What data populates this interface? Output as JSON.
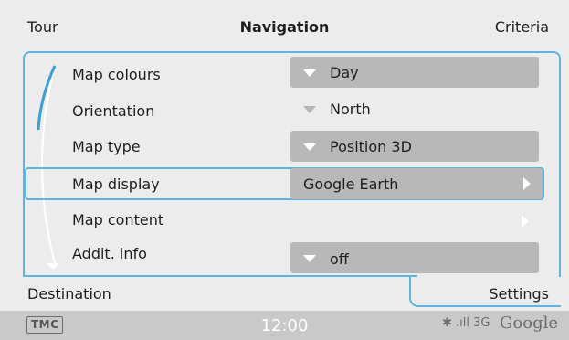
{
  "header": {
    "left_tab": "Tour",
    "title": "Navigation",
    "right_tab": "Criteria"
  },
  "settings": [
    {
      "label": "Map colours",
      "value": "Day",
      "control": "dropdown"
    },
    {
      "label": "Orientation",
      "value": "North",
      "control": "dropdown-disabled"
    },
    {
      "label": "Map type",
      "value": "Position 3D",
      "control": "dropdown"
    },
    {
      "label": "Map display",
      "value": "Google Earth",
      "control": "submenu",
      "selected": true
    },
    {
      "label": "Map content",
      "value": "",
      "control": "submenu"
    },
    {
      "label": "Addit. info",
      "value": "off",
      "control": "dropdown"
    }
  ],
  "footer": {
    "left_tab": "Destination",
    "right_tab": "Settings"
  },
  "status": {
    "tmc": "TMC",
    "time": "12:00",
    "signal_icons": "✱ .ıll 3G",
    "brand": "Google"
  },
  "colors": {
    "accent": "#5fb3dd",
    "background": "#ececec",
    "value_box": "#b8b8b8",
    "status_bar": "#c9c9c9"
  }
}
